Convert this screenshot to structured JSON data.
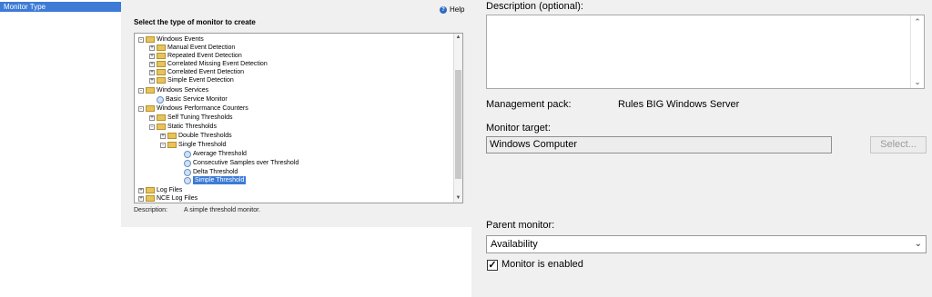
{
  "nav": {
    "items": [
      {
        "label": "Monitor Type"
      }
    ]
  },
  "wizard": {
    "help_label": "Help",
    "heading": "Select the type of monitor to create",
    "tree": [
      {
        "label": "Windows Events"
      },
      {
        "label": "Manual Event Detection"
      },
      {
        "label": "Repeated Event Detection"
      },
      {
        "label": "Correlated Missing Event Detection"
      },
      {
        "label": "Correlated Event Detection"
      },
      {
        "label": "Simple Event Detection"
      },
      {
        "label": "Windows Services"
      },
      {
        "label": "Basic Service Monitor"
      },
      {
        "label": "Windows Performance Counters"
      },
      {
        "label": "Self Tuning Thresholds"
      },
      {
        "label": "Static Thresholds"
      },
      {
        "label": "Double Thresholds"
      },
      {
        "label": "Single Threshold"
      },
      {
        "label": "Average Threshold"
      },
      {
        "label": "Consecutive Samples over Threshold"
      },
      {
        "label": "Delta Threshold"
      },
      {
        "label": "Simple Threshold"
      },
      {
        "label": "Log Files"
      },
      {
        "label": "NCE Log Files"
      }
    ],
    "description_label": "Description:",
    "description_value": "A simple threshold monitor."
  },
  "properties": {
    "description_label": "Description (optional):",
    "description_value": "",
    "management_pack_label": "Management pack:",
    "management_pack_value": "Rules BIG Windows Server",
    "monitor_target_label": "Monitor target:",
    "monitor_target_value": "Windows Computer",
    "select_button": "Select...",
    "parent_monitor_label": "Parent monitor:",
    "parent_monitor_value": "Availability",
    "enabled_label": "Monitor is enabled",
    "enabled_checked": true
  },
  "colors": {
    "selection": "#3d7bd6",
    "panel": "#f0f0f0",
    "folder": "#e7c35a"
  }
}
